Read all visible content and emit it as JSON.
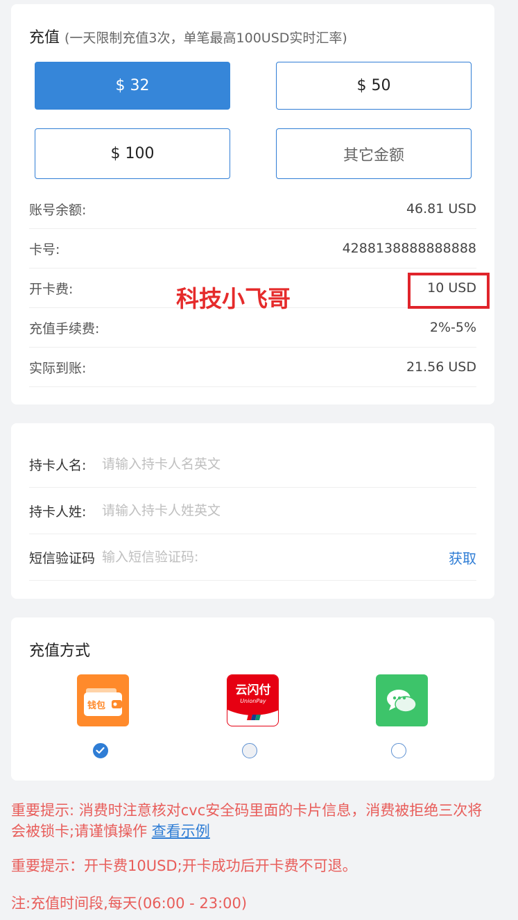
{
  "recharge": {
    "title": "充值",
    "subtitle": "(一天限制充值3次，单笔最高100USD实时汇率)",
    "amounts": [
      {
        "label": "$ 32"
      },
      {
        "label": "$ 50"
      },
      {
        "label": "$ 100"
      },
      {
        "label": "其它金额"
      }
    ],
    "selected_amount": "$ 32",
    "info": [
      {
        "label": "账号余额:",
        "value": "46.81 USD"
      },
      {
        "label": "卡号:",
        "value": "4288138888888888"
      },
      {
        "label": "开卡费:",
        "value": "10 USD"
      },
      {
        "label": "充值手续费:",
        "value": "2%-5%"
      },
      {
        "label": "实际到账:",
        "value": "21.56 USD"
      }
    ],
    "watermark": "科技小飞哥"
  },
  "holder": {
    "first_name": {
      "label": "持卡人名:",
      "placeholder": "请输入持卡人名英文",
      "value": ""
    },
    "last_name": {
      "label": "持卡人姓:",
      "placeholder": "请输入持卡人姓英文",
      "value": ""
    },
    "sms": {
      "label": "短信验证码",
      "placeholder": "输入短信验证码:",
      "value": "",
      "get_label": "获取"
    }
  },
  "payment": {
    "title": "充值方式",
    "methods": [
      {
        "icon": "wallet-icon",
        "text": "钱包",
        "color": "#ff8a2b",
        "selected": true
      },
      {
        "icon": "unionpay-icon",
        "text": "云闪付",
        "subtext": "UnionPay",
        "color": "#e60012",
        "selected": false
      },
      {
        "icon": "wechat-icon",
        "color": "#3dc46a",
        "selected": false
      }
    ]
  },
  "notices": {
    "notice1": "重要提示: 消费时注意核对cvc安全码里面的卡片信息，消费被拒绝三次将会被锁卡;请谨慎操作",
    "notice1_link": "查看示例",
    "notice2": "重要提示：开卡费10USD;开卡成功后开卡费不可退。",
    "notice3": "注:充值时间段,每天(06:00 - 23:00)"
  },
  "colors": {
    "primary": "#3686d9",
    "notice_red": "#e85d5a",
    "background": "#f2f3f5"
  }
}
